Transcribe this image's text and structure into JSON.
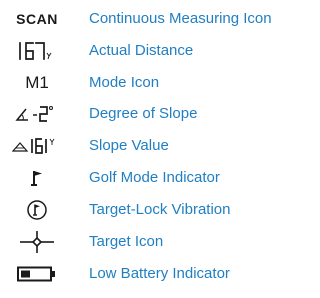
{
  "legend": {
    "items": [
      {
        "icon": "scan-text-icon",
        "icon_text": "SCAN",
        "label": "Continuous Measuring Icon"
      },
      {
        "icon": "distance-digits-icon",
        "label": "Actual Distance"
      },
      {
        "icon": "mode-text-icon",
        "icon_text": "M1",
        "label": "Mode Icon"
      },
      {
        "icon": "slope-angle-icon",
        "label": "Degree of Slope"
      },
      {
        "icon": "slope-value-icon",
        "label": "Slope Value"
      },
      {
        "icon": "golf-flag-icon",
        "label": "Golf Mode Indicator"
      },
      {
        "icon": "target-lock-vibration-icon",
        "label": "Target-Lock Vibration"
      },
      {
        "icon": "target-crosshair-icon",
        "label": "Target Icon"
      },
      {
        "icon": "low-battery-icon",
        "label": "Low Battery Indicator"
      }
    ]
  },
  "colors": {
    "label_text": "#1f7fc2",
    "icon": "#1a1a1a"
  }
}
